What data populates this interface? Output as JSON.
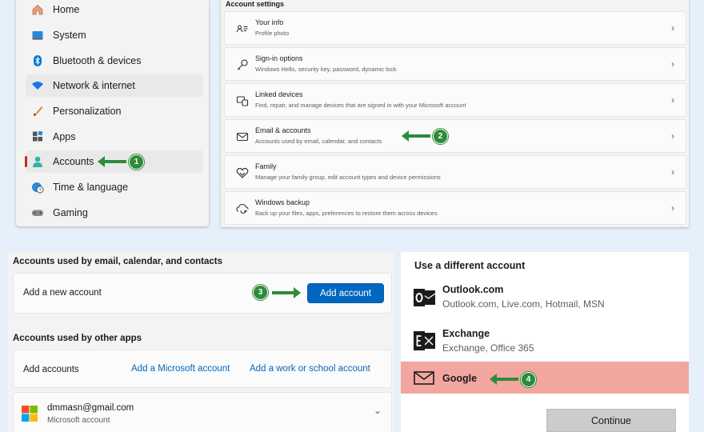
{
  "nav": {
    "items": [
      {
        "label": "Home",
        "icon": "home-icon"
      },
      {
        "label": "System",
        "icon": "system-icon"
      },
      {
        "label": "Bluetooth & devices",
        "icon": "bluetooth-icon"
      },
      {
        "label": "Network & internet",
        "icon": "wifi-icon"
      },
      {
        "label": "Personalization",
        "icon": "brush-icon"
      },
      {
        "label": "Apps",
        "icon": "apps-icon"
      },
      {
        "label": "Accounts",
        "icon": "person-icon"
      },
      {
        "label": "Time & language",
        "icon": "globe-clock-icon"
      },
      {
        "label": "Gaming",
        "icon": "gamepad-icon"
      }
    ],
    "selected": "Accounts"
  },
  "account_settings": {
    "heading": "Account settings",
    "rows": [
      {
        "title": "Your info",
        "subtitle": "Profile photo",
        "icon": "person-card-icon"
      },
      {
        "title": "Sign-in options",
        "subtitle": "Windows Hello, security key, password, dynamic lock",
        "icon": "key-icon"
      },
      {
        "title": "Linked devices",
        "subtitle": "Find, repair, and manage devices that are signed in with your Microsoft account",
        "icon": "devices-icon"
      },
      {
        "title": "Email & accounts",
        "subtitle": "Accounts used by email, calendar, and contacts",
        "icon": "mail-icon"
      },
      {
        "title": "Family",
        "subtitle": "Manage your family group, edit account types and device permissions",
        "icon": "heart-icon"
      },
      {
        "title": "Windows backup",
        "subtitle": "Back up your files, apps, preferences to restore them across devices",
        "icon": "backup-icon"
      }
    ]
  },
  "steps": [
    "1",
    "2",
    "3",
    "4"
  ],
  "email_panel": {
    "heading": "Accounts used by email, calendar, and contacts",
    "add_new_label": "Add a new account",
    "add_button": "Add account",
    "other_heading": "Accounts used by other apps",
    "add_accounts_label": "Add accounts",
    "ms_link": "Add a Microsoft account",
    "work_link": "Add a work or school account",
    "account_email": "dmmasn@gmail.com",
    "account_type": "Microsoft account"
  },
  "dialog": {
    "heading": "Use a different account",
    "options": [
      {
        "name": "Outlook.com",
        "desc": "Outlook.com, Live.com, Hotmail, MSN",
        "icon": "outlook-icon"
      },
      {
        "name": "Exchange",
        "desc": "Exchange, Office 365",
        "icon": "exchange-icon"
      },
      {
        "name": "Google",
        "desc": "",
        "icon": "envelope-icon"
      }
    ],
    "continue_button": "Continue"
  },
  "colors": {
    "accent": "#0067c0",
    "annotation": "#2e8b3a",
    "highlight": "#f3a6a0",
    "selection_bar": "#c42b1c"
  }
}
